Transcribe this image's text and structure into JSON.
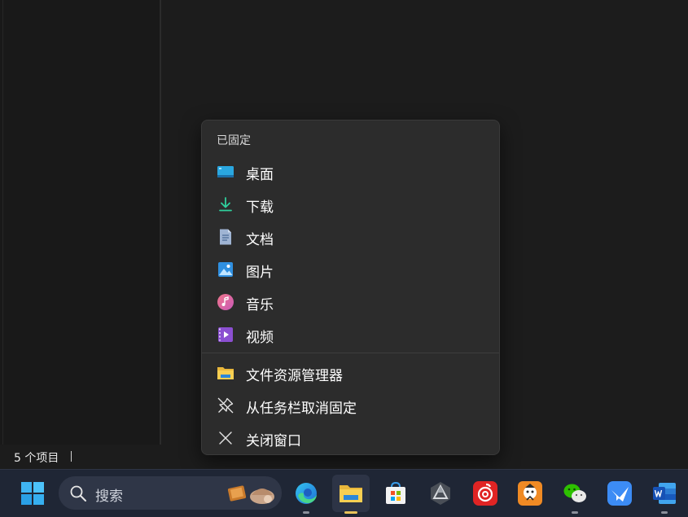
{
  "status_bar": {
    "item_count": "5 个项目"
  },
  "jumplist": {
    "section_title": "已固定",
    "pinned": [
      {
        "label": "桌面",
        "icon": "desktop-icon"
      },
      {
        "label": "下载",
        "icon": "download-icon"
      },
      {
        "label": "文档",
        "icon": "document-icon"
      },
      {
        "label": "图片",
        "icon": "pictures-icon"
      },
      {
        "label": "音乐",
        "icon": "music-icon"
      },
      {
        "label": "视频",
        "icon": "video-icon"
      }
    ],
    "actions": [
      {
        "label": "文件资源管理器",
        "icon": "file-explorer-icon"
      },
      {
        "label": "从任务栏取消固定",
        "icon": "unpin-icon"
      },
      {
        "label": "关闭窗口",
        "icon": "close-icon"
      }
    ]
  },
  "taskbar": {
    "search_placeholder": "搜索",
    "apps": [
      "start",
      "edge",
      "file-explorer",
      "microsoft-store",
      "app-hexagon",
      "netease-music",
      "game-app",
      "wechat",
      "feishu",
      "word"
    ],
    "running": [
      "edge",
      "file-explorer",
      "wechat",
      "word"
    ],
    "active": "file-explorer"
  },
  "colors": {
    "menu_bg": "#2c2c2c",
    "taskbar_bg": "#1f2635",
    "active_indicator": "#e8c35a"
  }
}
